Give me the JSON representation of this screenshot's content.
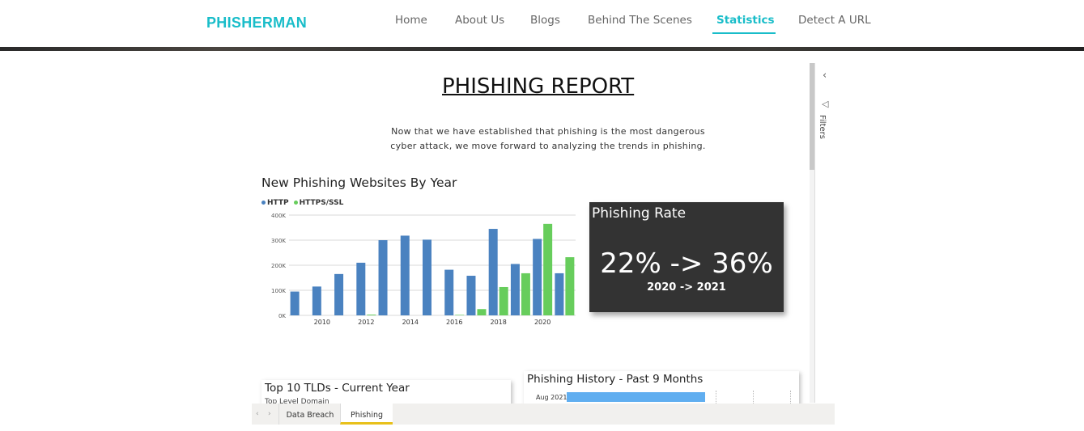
{
  "header": {
    "logo": "PHISHERMAN",
    "nav": [
      {
        "label": "Home"
      },
      {
        "label": "About Us"
      },
      {
        "label": "Blogs"
      },
      {
        "label": "Behind The Scenes"
      },
      {
        "label": "Statistics",
        "active": true
      },
      {
        "label": "Detect A URL"
      }
    ],
    "accent_color": "#19bdc9"
  },
  "report": {
    "title": "PHISHING REPORT",
    "intro_line1": "Now that we have established that phishing is the most dangerous",
    "intro_line2": "cyber attack, we move forward to analyzing the trends in phishing.",
    "kpi": {
      "title": "Phishing Rate",
      "value": "22% -> 36%",
      "subtitle": "2020 -> 2021",
      "background": "#333333"
    },
    "tld_tile": {
      "title": "Top 10 TLDs - Current Year",
      "column_header": "Top Level Domain"
    },
    "history_tile": {
      "title": "Phishing History - Past 9 Months",
      "first_row_label": "Aug 2021"
    },
    "tabs": [
      {
        "label": "Data Breach"
      },
      {
        "label": "Phishing",
        "active": true
      }
    ],
    "filters_label": "Filters"
  },
  "chart_data": {
    "type": "bar",
    "title": "New Phishing Websites By Year",
    "categories": [
      "2009",
      "2010",
      "2011",
      "2012",
      "2013",
      "2014",
      "2015",
      "2016",
      "2017",
      "2018",
      "2019",
      "2020",
      "2021"
    ],
    "x_tick_labels": [
      "2010",
      "2012",
      "2014",
      "2016",
      "2018",
      "2020"
    ],
    "y_tick_labels": [
      "0K",
      "100K",
      "200K",
      "300K",
      "400K"
    ],
    "ylim": [
      0,
      400000
    ],
    "grid": true,
    "legend": "top-left",
    "series": [
      {
        "name": "HTTP",
        "color": "#4a82c0",
        "values": [
          95000,
          115000,
          165000,
          210000,
          300000,
          318000,
          302000,
          182000,
          158000,
          345000,
          205000,
          305000,
          168000
        ]
      },
      {
        "name": "HTTPS/SSL",
        "color": "#67cd5c",
        "values": [
          0,
          0,
          0,
          3000,
          0,
          0,
          0,
          2000,
          25000,
          113000,
          168000,
          365000,
          232000
        ]
      }
    ]
  }
}
